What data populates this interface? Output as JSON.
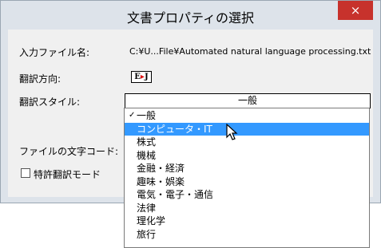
{
  "window": {
    "title": "文書プロパティの選択",
    "close_glyph": "×"
  },
  "fields": {
    "input_file_label": "入力ファイル名:",
    "input_file_value": "C:¥U...File¥Automated natural language processing.txt",
    "direction_label": "翻訳方向:",
    "direction_value": {
      "from": "E",
      "arrow": "▸",
      "to": "J"
    },
    "style_label": "翻訳スタイル:",
    "style_value": "一般",
    "encoding_label": "ファイルの文字コード:",
    "patent_mode_label": "特許翻訳モード"
  },
  "dropdown": {
    "checked_index": 0,
    "selected_index": 1,
    "check_glyph": "✓",
    "items": [
      "一般",
      "コンピュータ・IT",
      "株式",
      "機械",
      "金融・経済",
      "趣味・娯楽",
      "電気・電子・通信",
      "法律",
      "理化学",
      "旅行"
    ]
  }
}
